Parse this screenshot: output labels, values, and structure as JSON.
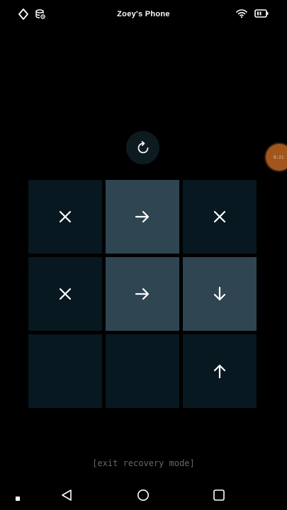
{
  "status_bar": {
    "device_name": "Zoey's Phone",
    "left_icons": [
      "diamond-icon",
      "storage-sync-icon"
    ],
    "right_icons": [
      "wifi-icon",
      "battery-icon"
    ]
  },
  "floating_bubble": {
    "text": "8:21"
  },
  "reset_button": {
    "icon": "refresh-icon"
  },
  "grid": {
    "tiles": [
      {
        "style": "dark",
        "icon": "close-icon"
      },
      {
        "style": "light",
        "icon": "arrow-right-icon"
      },
      {
        "style": "dark",
        "icon": "close-icon"
      },
      {
        "style": "dark",
        "icon": "close-icon"
      },
      {
        "style": "light",
        "icon": "arrow-right-icon"
      },
      {
        "style": "light",
        "icon": "arrow-down-icon"
      },
      {
        "style": "empty",
        "icon": ""
      },
      {
        "style": "empty",
        "icon": ""
      },
      {
        "style": "dark",
        "icon": "arrow-up-icon"
      }
    ]
  },
  "exit_link": {
    "label": "[exit recovery mode]"
  },
  "nav_bar": {
    "items": [
      "menu-dot-icon",
      "back-icon",
      "home-icon",
      "recents-icon"
    ]
  },
  "colors": {
    "background": "#000000",
    "tile_dark": "#081820",
    "tile_light": "#2f4552",
    "reset_bg": "#0d1b21",
    "bubble": "#a0561c",
    "link_text": "#5f6a70"
  }
}
